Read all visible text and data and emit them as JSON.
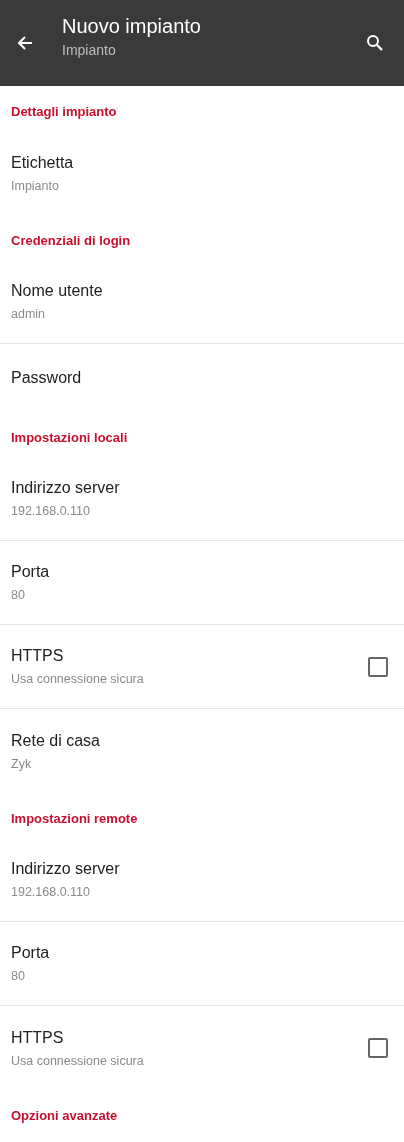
{
  "app_bar": {
    "title": "Nuovo impianto",
    "subtitle": "Impianto"
  },
  "sections": [
    {
      "title": "Dettagli impianto",
      "items": [
        {
          "kind": "text",
          "label": "Etichetta",
          "value": "Impianto"
        }
      ]
    },
    {
      "title": "Credenziali di login",
      "items": [
        {
          "kind": "text",
          "label": "Nome utente",
          "value": "admin"
        },
        {
          "kind": "text",
          "label": "Password"
        }
      ]
    },
    {
      "title": "Impostazioni locali",
      "items": [
        {
          "kind": "text",
          "label": "Indirizzo server",
          "value": "192.168.0.110"
        },
        {
          "kind": "text",
          "label": "Porta",
          "value": "80"
        },
        {
          "kind": "checkbox",
          "label": "HTTPS",
          "value": "Usa connessione sicura",
          "checked": false
        },
        {
          "kind": "text",
          "label": "Rete di casa",
          "value": "Zyk"
        }
      ]
    },
    {
      "title": "Impostazioni remote",
      "items": [
        {
          "kind": "text",
          "label": "Indirizzo server",
          "value": "192.168.0.110"
        },
        {
          "kind": "text",
          "label": "Porta",
          "value": "80"
        },
        {
          "kind": "checkbox",
          "label": "HTTPS",
          "value": "Usa connessione sicura",
          "checked": false
        }
      ]
    },
    {
      "title": "Opzioni avanzate"
    }
  ]
}
